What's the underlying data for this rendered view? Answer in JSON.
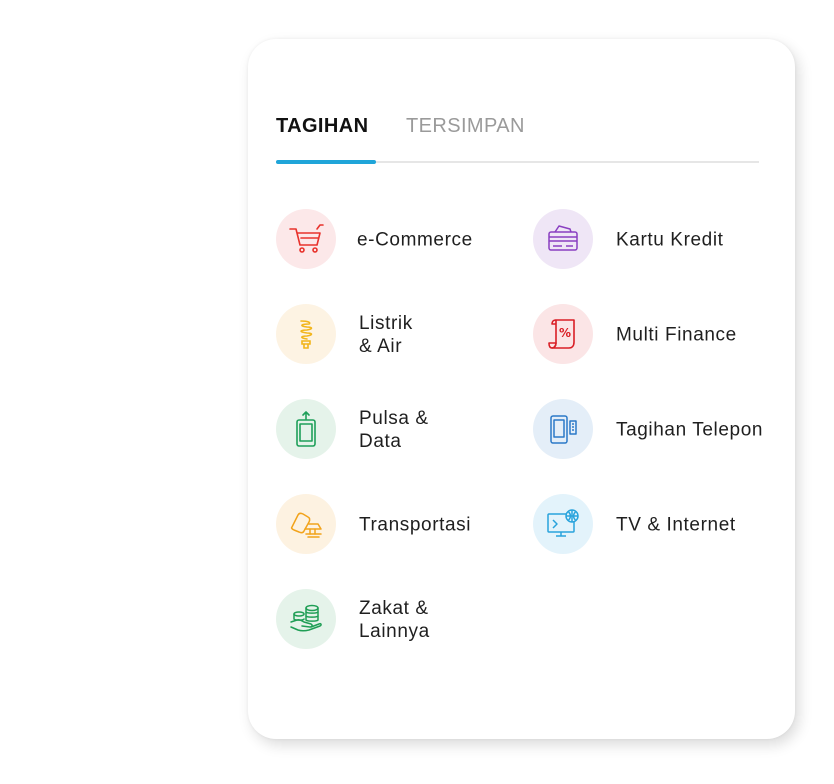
{
  "tabs": [
    {
      "label": "TAGIHAN",
      "active": true
    },
    {
      "label": "TERSIMPAN",
      "active": false
    }
  ],
  "items": [
    {
      "line1": "e-Commerce",
      "line2": "",
      "icon": "shopping-cart-icon",
      "color": "#e8322c",
      "bg": "#fce8e9"
    },
    {
      "line1": "Kartu Kredit",
      "line2": "",
      "icon": "credit-card-icon",
      "color": "#8a3fc1",
      "bg": "#efe6f6"
    },
    {
      "line1": "Listrik",
      "line2": "& Air",
      "icon": "light-bulb-icon",
      "color": "#f2b51b",
      "bg": "#fdf3e3"
    },
    {
      "line1": "Multi Finance",
      "line2": "",
      "icon": "percent-document-icon",
      "color": "#d91f26",
      "bg": "#fbe5e6"
    },
    {
      "line1": "Pulsa &",
      "line2": "Data",
      "icon": "mobile-data-icon",
      "color": "#1fa05a",
      "bg": "#e5f3ea"
    },
    {
      "line1": "Tagihan Telepon",
      "line2": "",
      "icon": "phone-bill-icon",
      "color": "#2b79c7",
      "bg": "#e4eef8"
    },
    {
      "line1": "Transportasi",
      "line2": "",
      "icon": "transport-ticket-icon",
      "color": "#f2a31b",
      "bg": "#fdf2e1"
    },
    {
      "line1": "TV & Internet",
      "line2": "",
      "icon": "tv-internet-icon",
      "color": "#29a3dc",
      "bg": "#e3f3fb"
    },
    {
      "line1": "Zakat &",
      "line2": "Lainnya",
      "icon": "hand-coins-icon",
      "color": "#1f9e55",
      "bg": "#e5f3ea"
    }
  ]
}
